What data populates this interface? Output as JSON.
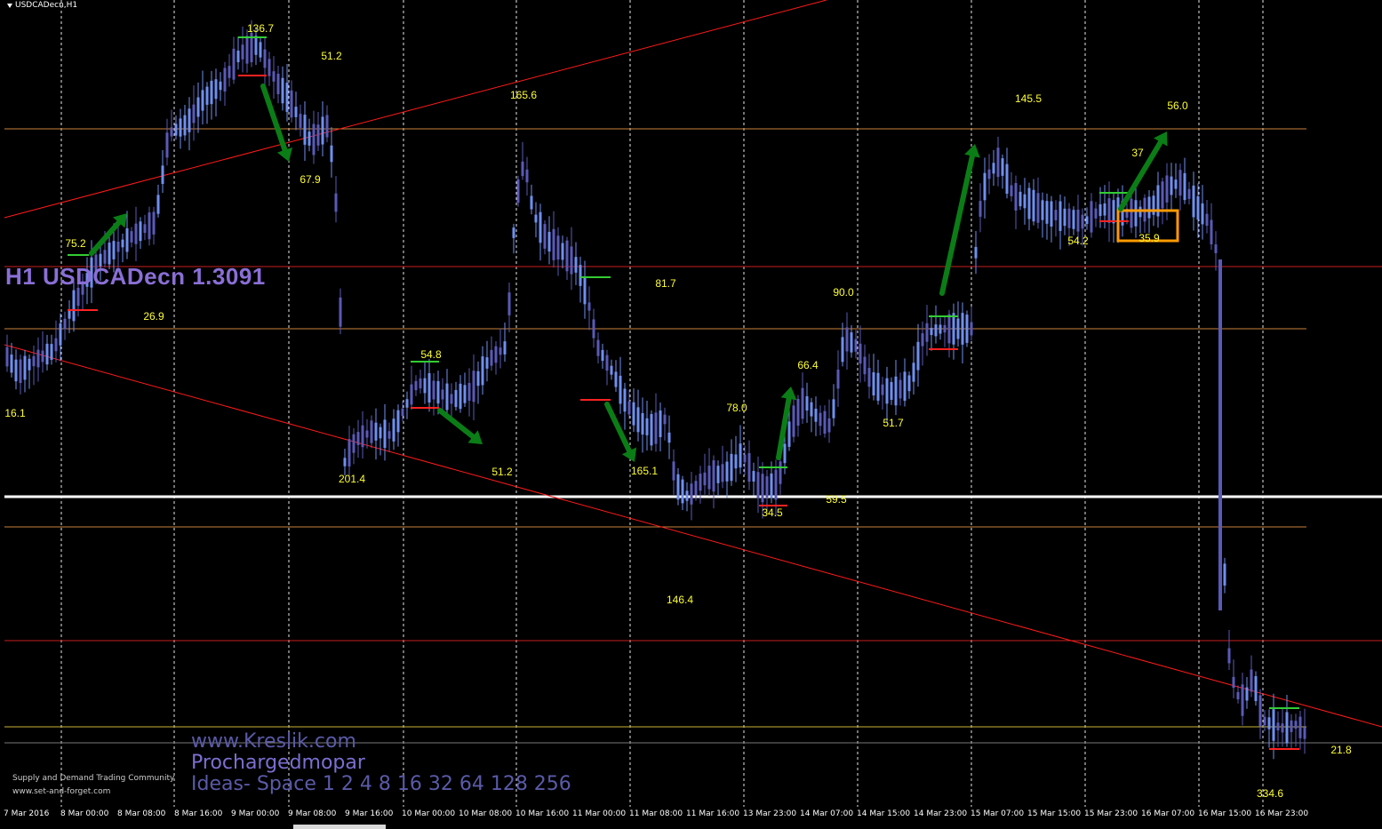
{
  "window": {
    "title": "USDCADecn,H1",
    "symbol_label": "H1 USDCADecn 1.3091"
  },
  "watermark": {
    "line1": "www.Kreslik.com",
    "line2": "Prochargedmopar",
    "line3": "Ideas- Space 1 2 4 8 16 32 64 128 256",
    "community1": "Supply and Demand Trading Community",
    "community2": "www.set-and-forget.com"
  },
  "colors": {
    "background": "#000000",
    "candle": "#6f8ff0",
    "candle_dark": "#5a5ab8",
    "value_label": "#ffff33",
    "trendline": "#ff1a1a",
    "arrow": "#0b7d16",
    "support_mark": "#ff2222",
    "resistance_mark": "#33cc33",
    "level_orange": "#c8823a",
    "level_red": "#c81e1e",
    "current_price_line": "#ffffff",
    "highlight_box": "#ff9a00"
  },
  "time_axis": [
    "7 Mar 2016",
    "8 Mar 00:00",
    "8 Mar 08:00",
    "8 Mar 16:00",
    "9 Mar 00:00",
    "9 Mar 08:00",
    "9 Mar 16:00",
    "10 Mar 00:00",
    "10 Mar 08:00",
    "10 Mar 16:00",
    "11 Mar 00:00",
    "11 Mar 08:00",
    "11 Mar 16:00",
    "13 Mar 23:00",
    "14 Mar 07:00",
    "14 Mar 15:00",
    "14 Mar 23:00",
    "15 Mar 07:00",
    "15 Mar 15:00",
    "15 Mar 23:00",
    "16 Mar 07:00",
    "16 Mar 15:00",
    "16 Mar 23:00"
  ],
  "value_labels": [
    "136.7",
    "51.2",
    "165.6",
    "67.9",
    "75.2",
    "26.9",
    "16.1",
    "54.8",
    "201.4",
    "51.2",
    "81.7",
    "165.1",
    "146.4",
    "78.0",
    "34.5",
    "59.5",
    "66.4",
    "90.0",
    "51.7",
    "145.5",
    "54.2",
    "37",
    "35.9",
    "56.0",
    "21.8",
    "334.6"
  ],
  "annotations": {
    "arrow_count": 9,
    "highlight_box": "orange-rectangle"
  }
}
